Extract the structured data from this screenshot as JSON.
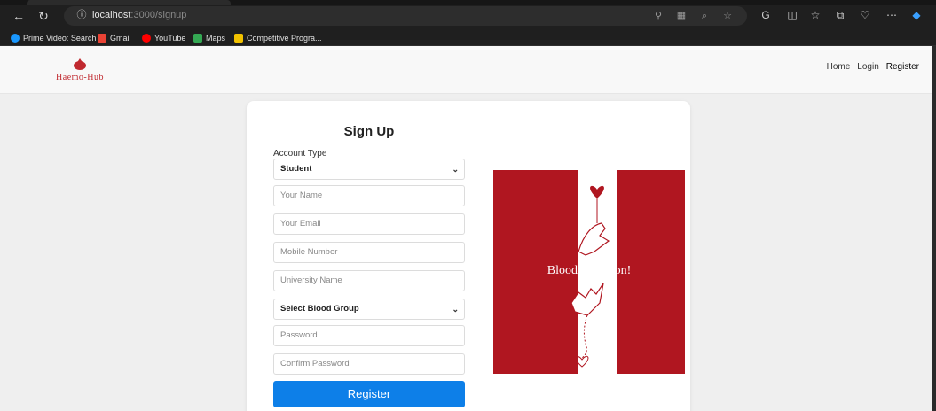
{
  "browser": {
    "url_host": "localhost",
    "url_path": ":3000/signup",
    "bookmarks": [
      {
        "label": "Prime Video: Search",
        "color": "#1a98ff"
      },
      {
        "label": "Gmail",
        "color": "#ea4335"
      },
      {
        "label": "YouTube",
        "color": "#ff0000"
      },
      {
        "label": "Maps",
        "color": "#34a853"
      },
      {
        "label": "Competitive Progra...",
        "color": "#f2c200"
      }
    ]
  },
  "site": {
    "logo_text": "Haemo-Hub",
    "brand_color": "#c0292f",
    "nav": [
      "Home",
      "Login",
      "Register"
    ]
  },
  "form": {
    "title": "Sign Up",
    "account_type_label": "Account Type",
    "account_type_value": "Student",
    "name_placeholder": "Your Name",
    "email_placeholder": "Your Email",
    "mobile_placeholder": "Mobile Number",
    "university_placeholder": "University Name",
    "blood_group_value": "Select Blood Group",
    "password_placeholder": "Password",
    "confirm_placeholder": "Confirm Password",
    "submit_label": "Register",
    "submit_color": "#0d7fe8"
  },
  "poster": {
    "caption": "Blood Donation!",
    "background": "#b01620"
  }
}
